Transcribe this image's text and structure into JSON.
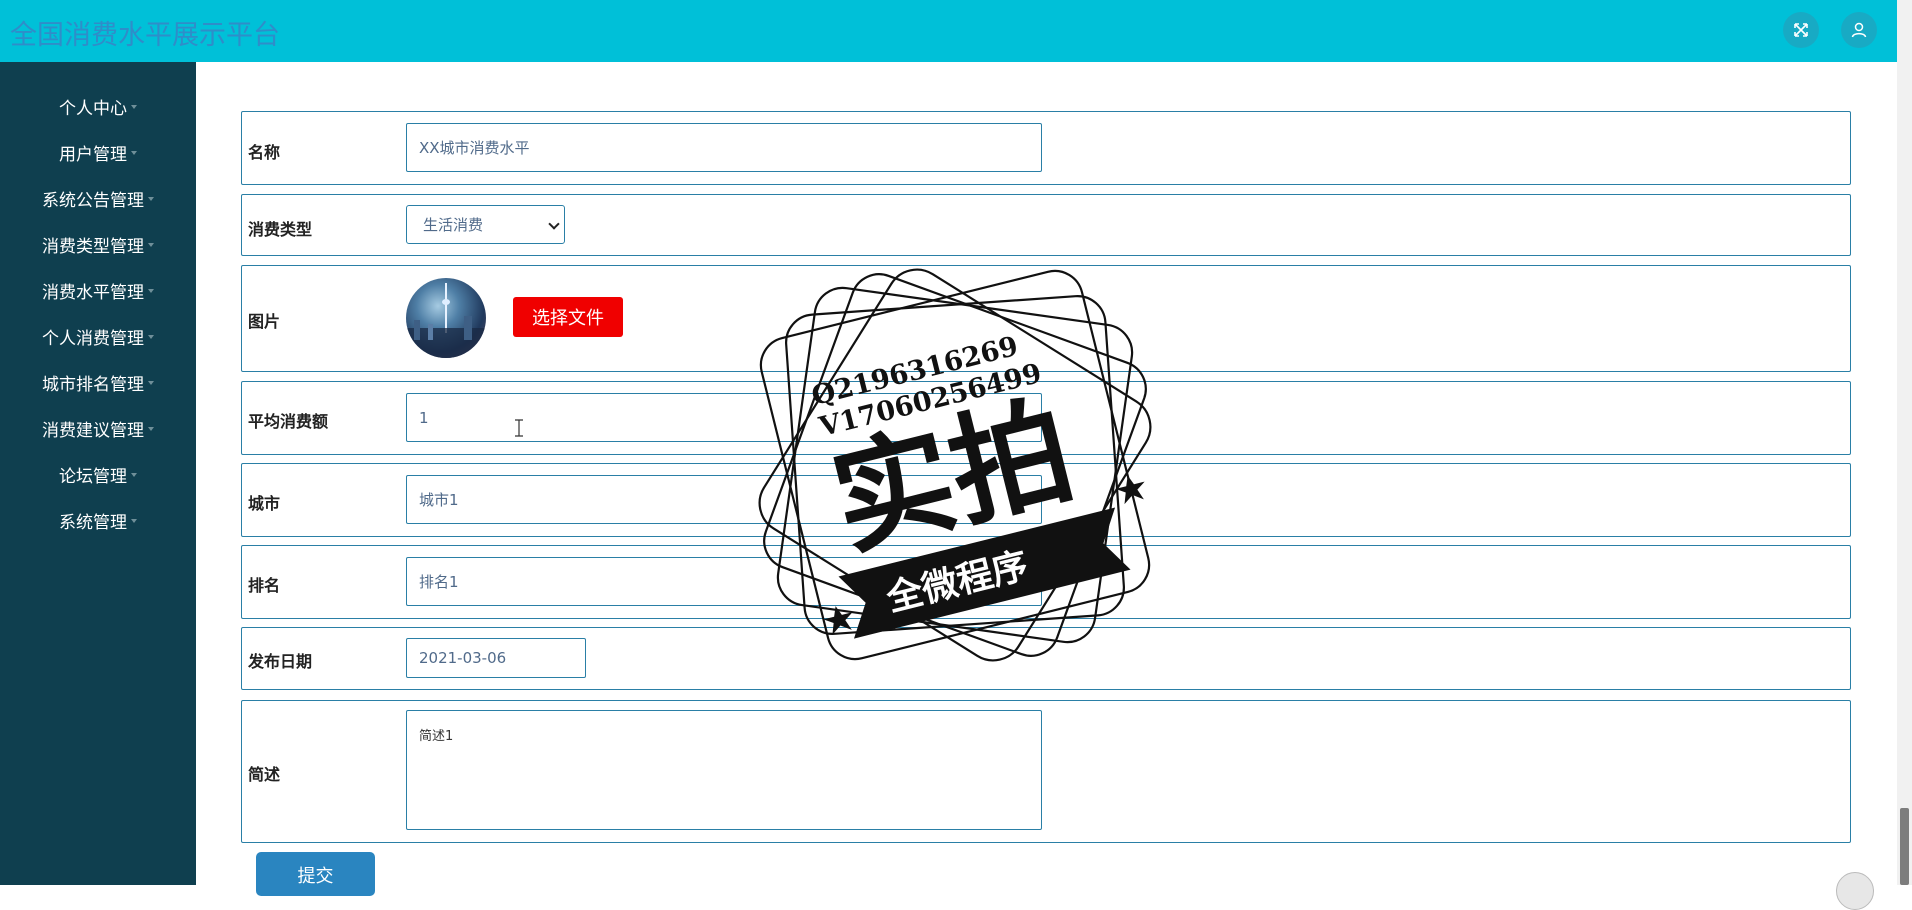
{
  "header": {
    "title": "全国消费水平展示平台",
    "icons": [
      "fullscreen-icon",
      "user-icon"
    ]
  },
  "sidebar": {
    "items": [
      {
        "label": "个人中心"
      },
      {
        "label": "用户管理"
      },
      {
        "label": "系统公告管理"
      },
      {
        "label": "消费类型管理"
      },
      {
        "label": "消费水平管理"
      },
      {
        "label": "个人消费管理"
      },
      {
        "label": "城市排名管理"
      },
      {
        "label": "消费建议管理"
      },
      {
        "label": "论坛管理"
      },
      {
        "label": "系统管理"
      }
    ]
  },
  "form": {
    "name": {
      "label": "名称",
      "value": "XX城市消费水平"
    },
    "type": {
      "label": "消费类型",
      "value": "生活消费"
    },
    "image": {
      "label": "图片",
      "button": "选择文件"
    },
    "avg": {
      "label": "平均消费额",
      "value": "1"
    },
    "city": {
      "label": "城市",
      "value": "城市1"
    },
    "rank": {
      "label": "排名",
      "value": "排名1"
    },
    "date": {
      "label": "发布日期",
      "value": "2021-03-06"
    },
    "summary": {
      "label": "简述",
      "value": "简述1"
    },
    "submit": "提交"
  },
  "watermark": {
    "line1": "Q2196316269",
    "line2": "V17060256499",
    "main": "实拍",
    "banner": "全微程序"
  },
  "colors": {
    "header_bg": "#00c0d8",
    "sidebar_bg": "#0f3f4f",
    "accent_border": "#2a7fa6",
    "file_button": "#f00000",
    "submit_button": "#2a85c0"
  }
}
